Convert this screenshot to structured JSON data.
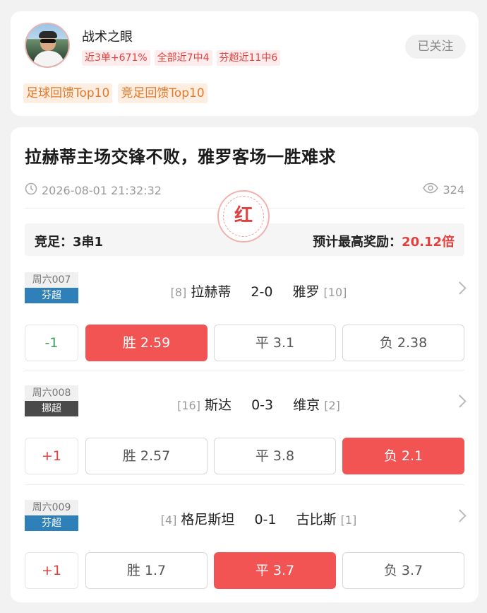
{
  "profile": {
    "name": "战术之眼",
    "stats": [
      "近3单+671%",
      "全部近7中4",
      "芬超近11中6"
    ],
    "follow_label": "已关注",
    "ranks": [
      "足球回馈Top10",
      "竞足回馈Top10"
    ]
  },
  "post": {
    "title": "拉赫蒂主场交锋不败，雅罗客场一胜难求",
    "datetime": "2026-08-01 21:32:32",
    "views": "324",
    "stamp": "红",
    "bet_type": "竞足：3串1",
    "max_reward_label": "预计最高奖励：",
    "max_reward_value": "20.12倍"
  },
  "matches": [
    {
      "code": "周六007",
      "league": "芬超",
      "league_color": "#2f7fb8",
      "home_rank": "[8]",
      "home": "拉赫蒂",
      "score": "2-0",
      "away": "雅罗",
      "away_rank": "[10]",
      "handicap": "-1",
      "handicap_color": "#3aa155",
      "win": "胜 2.59",
      "draw": "平 3.1",
      "lose": "负 2.38",
      "selected": "win"
    },
    {
      "code": "周六008",
      "league": "挪超",
      "league_color": "#4a4a4a",
      "home_rank": "[16]",
      "home": "斯达",
      "score": "0-3",
      "away": "维京",
      "away_rank": "[2]",
      "handicap": "+1",
      "handicap_color": "#e0413f",
      "win": "胜 2.57",
      "draw": "平 3.8",
      "lose": "负 2.1",
      "selected": "lose"
    },
    {
      "code": "周六009",
      "league": "芬超",
      "league_color": "#2f7fb8",
      "home_rank": "[4]",
      "home": "格尼斯坦",
      "score": "0-1",
      "away": "古比斯",
      "away_rank": "[1]",
      "handicap": "+1",
      "handicap_color": "#e0413f",
      "win": "胜 1.7",
      "draw": "平 3.7",
      "lose": "负 3.7",
      "selected": "draw"
    }
  ]
}
